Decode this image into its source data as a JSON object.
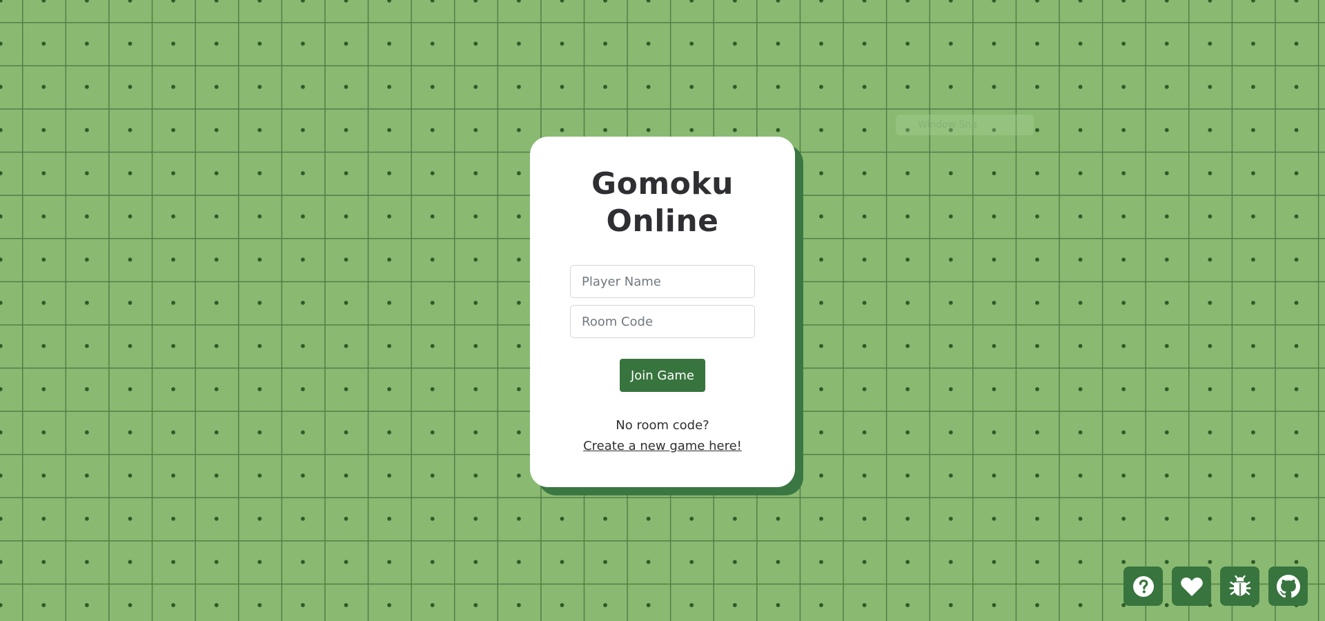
{
  "app": {
    "title": "Gomoku Online"
  },
  "card": {
    "title_line1": "Gomoku",
    "title_line2": "Online",
    "player_name_placeholder": "Player Name",
    "room_code_placeholder": "Room Code",
    "join_label": "Join Game",
    "no_code_text": "No room code?",
    "create_link_text": "Create a new game here!"
  },
  "watermark": {
    "text": "Window Sna"
  },
  "icons": [
    {
      "name": "help-icon"
    },
    {
      "name": "heart-icon"
    },
    {
      "name": "bug-icon"
    },
    {
      "name": "github-icon"
    }
  ],
  "colors": {
    "background": "#8aba72",
    "grid_line": "#4f7e45",
    "accent": "#38743e",
    "card": "#ffffff",
    "text": "#2f2f33"
  }
}
